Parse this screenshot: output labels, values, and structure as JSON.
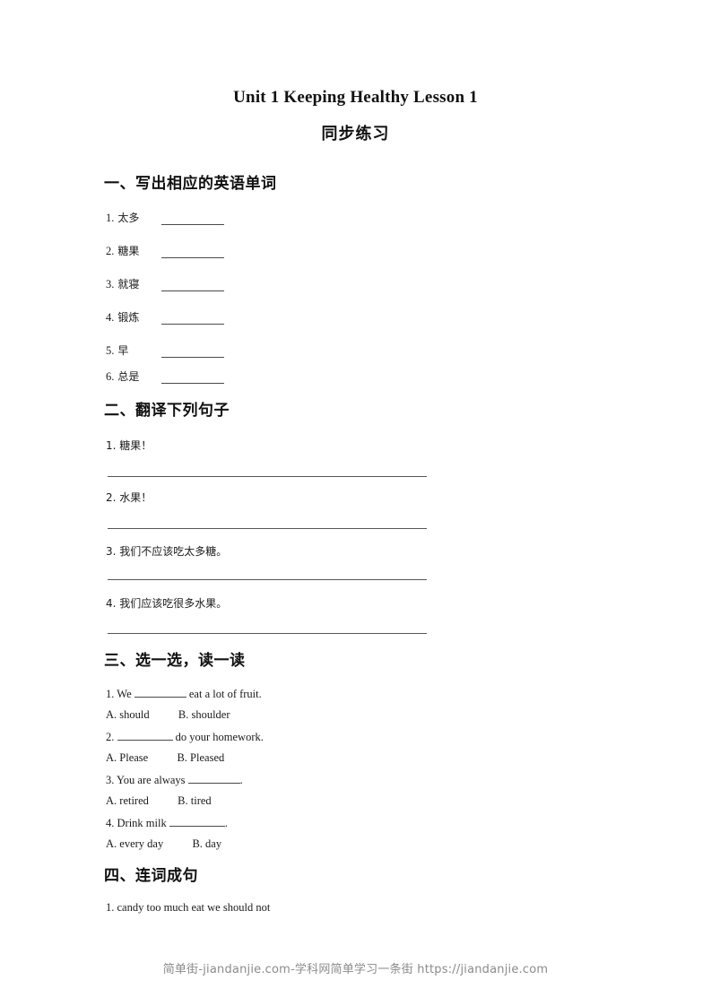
{
  "document": {
    "title": "Unit 1 Keeping Healthy Lesson 1",
    "subtitle": "同步练习"
  },
  "section1": {
    "heading": "一、写出相应的英语单词",
    "items": [
      {
        "num": "1.",
        "word": "太多"
      },
      {
        "num": "2.",
        "word": "糖果"
      },
      {
        "num": "3.",
        "word": "就寝"
      },
      {
        "num": "4.",
        "word": "锻炼"
      },
      {
        "num": "5.",
        "word": "早"
      },
      {
        "num": "6.",
        "word": "总是"
      }
    ]
  },
  "section2": {
    "heading": "二、翻译下列句子",
    "items": [
      {
        "text": "1. 糖果！"
      },
      {
        "text": "2. 水果！"
      },
      {
        "text": "3. 我们不应该吃太多糖。"
      },
      {
        "text": "4. 我们应该吃很多水果。"
      }
    ]
  },
  "section3": {
    "heading": "三、选一选，读一读",
    "questions": [
      {
        "prompt_before": "1. We",
        "prompt_after": "eat a lot of fruit.",
        "option_a": "A. should",
        "option_b": "B. shoulder"
      },
      {
        "prompt_before": "2.",
        "prompt_after": "do your homework.",
        "option_a": "A. Please",
        "option_b": "B. Pleased"
      },
      {
        "prompt_before": "3. You are always",
        "prompt_after": ".",
        "option_a": "A. retired",
        "option_b": "B. tired"
      },
      {
        "prompt_before": "4. Drink milk",
        "prompt_after": ".",
        "option_a": "A. every day",
        "option_b": "B. day"
      }
    ]
  },
  "section4": {
    "heading": "四、连词成句",
    "items": [
      {
        "text": "1. candy too much eat we should not"
      }
    ]
  },
  "footer": {
    "text": "简单街-jiandanjie.com-学科网简单学习一条街 https://jiandanjie.com"
  }
}
